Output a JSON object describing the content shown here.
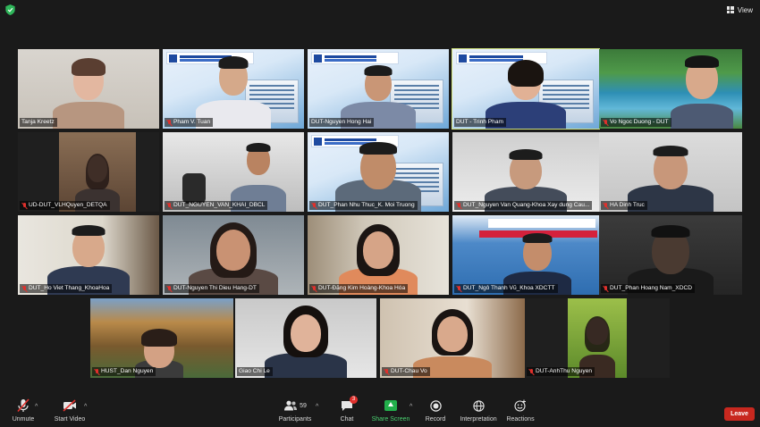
{
  "topbar": {
    "view_label": "View"
  },
  "tiles": [
    {
      "name": "Tanja Kreetz",
      "muted": false
    },
    {
      "name": "Pham V. Tuan",
      "muted": true
    },
    {
      "name": "DUT-Nguyen Hong Hai",
      "muted": false
    },
    {
      "name": "DUT - Trinh Pham",
      "muted": false
    },
    {
      "name": "Vo Ngoc Duong - DUT",
      "muted": true
    },
    {
      "name": "UD-DUT_VLHQuyen_DETQA",
      "muted": true
    },
    {
      "name": "DUT_NGUYEN_VAN_KHAI_DBCL",
      "muted": true
    },
    {
      "name": "DUT_Phan Nhu Thuc_K. Moi Truong",
      "muted": true
    },
    {
      "name": "DUT_Nguyen Van Quang-Khoa Xay dung Cau...",
      "muted": true
    },
    {
      "name": "HA Dinh Truc",
      "muted": true
    },
    {
      "name": "DUT_Ho Viet Thang_KhoaHoa",
      "muted": true
    },
    {
      "name": "DUT-Nguyen Thi Dieu Hang-DT",
      "muted": true
    },
    {
      "name": "DUT-Đặng Kim Hoàng-Khoa Hóa",
      "muted": true
    },
    {
      "name": "DUT_Ngô Thanh Vũ_Khoa XDCTT",
      "muted": true
    },
    {
      "name": "DUT_Phan Hoang Nam_XDCD",
      "muted": true
    },
    {
      "name": "HUST_Dan Nguyen",
      "muted": true
    },
    {
      "name": "Giao Chi Le",
      "muted": false
    },
    {
      "name": "DUT-Chau Vo",
      "muted": true
    },
    {
      "name": "DUT-AnhThu Nguyen",
      "muted": true
    }
  ],
  "toolbar": {
    "unmute": "Unmute",
    "start_video": "Start Video",
    "participants": "Participants",
    "participants_count": "59",
    "chat": "Chat",
    "chat_badge": "3",
    "share_screen": "Share Screen",
    "record": "Record",
    "interpretation": "Interpretation",
    "reactions": "Reactions",
    "leave": "Leave"
  },
  "colors": {
    "background": "#1a1a1a",
    "active_speaker": "#d2e37e",
    "share_green": "#22b04b",
    "leave_red": "#c8281f",
    "muted_red": "#e0302c"
  }
}
